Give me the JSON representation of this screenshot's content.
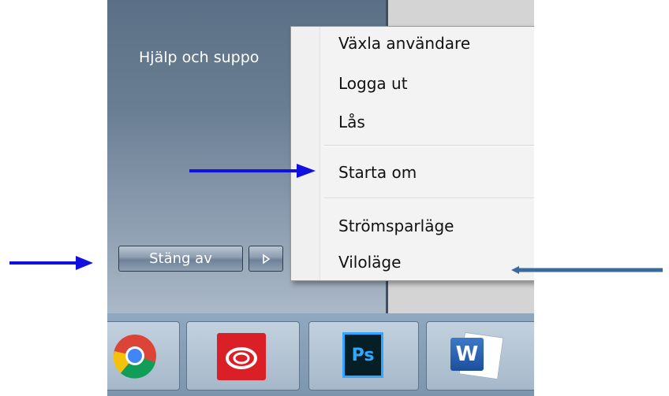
{
  "start_menu": {
    "help_item": "Hjälp och suppo",
    "shutdown_button": "Stäng av"
  },
  "power_menu": {
    "items": [
      "Växla användare",
      "Logga ut",
      "Lås",
      "Starta om",
      "Strömsparläge",
      "Viloläge"
    ]
  },
  "taskbar": {
    "apps": [
      {
        "name": "Google Chrome",
        "icon": "chrome-icon"
      },
      {
        "name": "Adobe Creative Cloud",
        "icon": "creative-cloud-icon"
      },
      {
        "name": "Adobe Photoshop",
        "icon": "photoshop-icon",
        "label": "Ps"
      },
      {
        "name": "Microsoft Word",
        "icon": "word-icon",
        "label": "W"
      }
    ]
  },
  "colors": {
    "annotation_arrow": "#1010e0",
    "annotation_arrow_alt": "#3a6a9c",
    "start_panel": "#6a7e93"
  }
}
